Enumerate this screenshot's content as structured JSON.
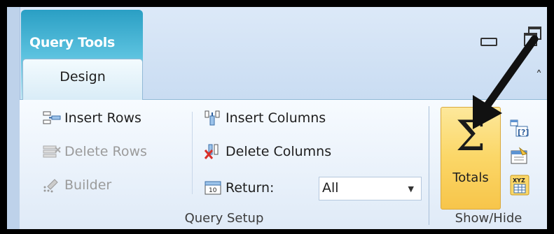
{
  "contextual_tab": {
    "label": "Query Tools"
  },
  "tabs": [
    {
      "label": "Design",
      "selected": true
    }
  ],
  "groups": {
    "query_setup": {
      "label": "Query Setup",
      "insert_rows": "Insert Rows",
      "delete_rows": "Delete Rows",
      "builder": "Builder",
      "insert_columns": "Insert Columns",
      "delete_columns": "Delete Columns",
      "return_label": "Return:",
      "return_value": "All"
    },
    "show_hide": {
      "label": "Show/Hide",
      "totals": "Totals",
      "xyz_icon_text": "XYZ"
    }
  },
  "colors": {
    "contextual_accent": "#3aa9cf",
    "totals_highlight": "#fbd768",
    "delete_red": "#d9302a"
  },
  "icons": [
    "insert-rows-icon",
    "delete-rows-icon",
    "builder-icon",
    "insert-columns-icon",
    "delete-columns-icon",
    "return-icon",
    "sigma-icon",
    "parameters-icon",
    "property-sheet-icon",
    "table-names-icon",
    "minimize-icon",
    "restore-icon",
    "collapse-ribbon-icon",
    "arrow-annotation"
  ]
}
